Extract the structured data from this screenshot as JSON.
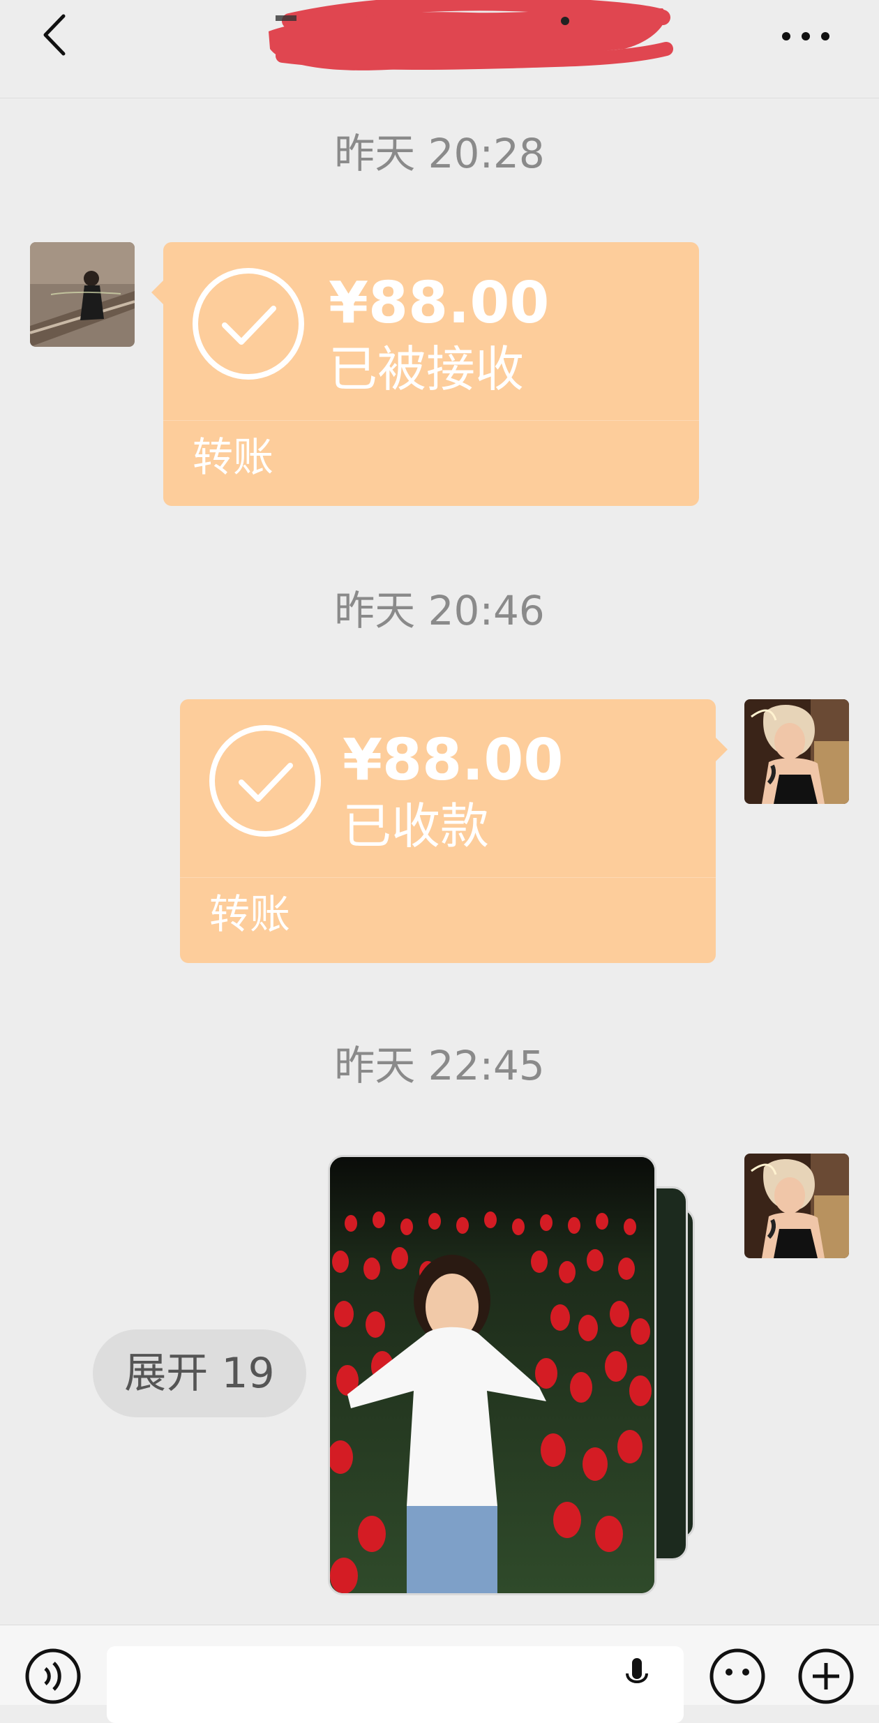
{
  "header": {
    "back_icon": "chevron-left-icon",
    "title": "",
    "more_icon": "more-dots-icon",
    "redaction_color": "#e04650"
  },
  "messages": [
    {
      "timestamp": "昨天 20:28",
      "direction": "incoming",
      "type": "transfer",
      "amount": "¥88.00",
      "status": "已被接收",
      "type_label": "转账"
    },
    {
      "timestamp": "昨天 20:46",
      "direction": "outgoing",
      "type": "transfer",
      "amount": "¥88.00",
      "status": "已收款",
      "type_label": "转账"
    },
    {
      "timestamp": "昨天 22:45",
      "direction": "outgoing",
      "type": "image-stack",
      "expand_label": "展开 19"
    }
  ],
  "bottom_bar": {
    "voice_icon": "voice-icon",
    "input_value": "",
    "mic_icon": "microphone-icon",
    "emoji_icon": "emoji-icon",
    "plus_icon": "plus-icon"
  },
  "colors": {
    "background": "#ededed",
    "transfer_bubble": "#fdcd9b",
    "timestamp_text": "#8a8a8a"
  }
}
